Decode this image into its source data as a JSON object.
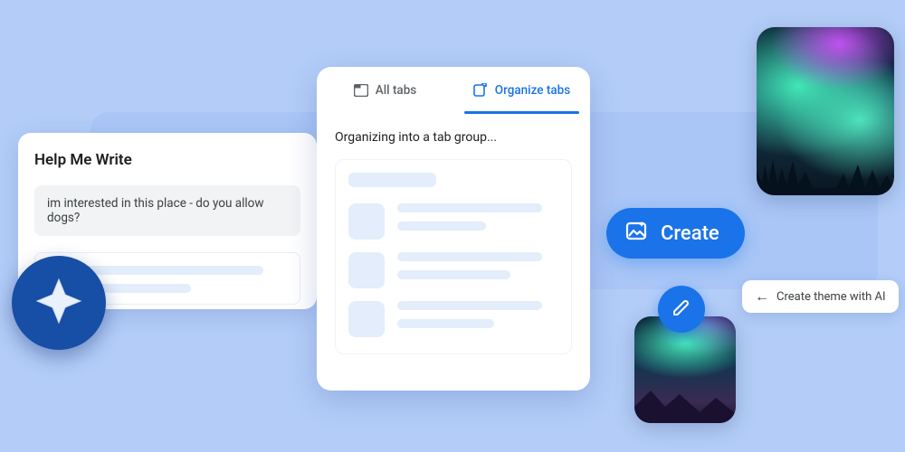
{
  "help_me_write": {
    "title": "Help Me Write",
    "input_text": "im interested in this place - do you allow dogs?"
  },
  "organize_tabs": {
    "tabs": [
      {
        "label": "All tabs",
        "icon": "tab-icon",
        "active": false
      },
      {
        "label": "Organize tabs",
        "icon": "organize-icon",
        "active": true
      }
    ],
    "status": "Organizing into a tab group..."
  },
  "create_button": {
    "label": "Create"
  },
  "theme_chip": {
    "label": "Create theme with AI",
    "arrow": "←"
  },
  "images": {
    "big": "aurora-large",
    "small": "aurora-small"
  },
  "icons": {
    "spark": "sparkle-icon",
    "edit": "pencil-icon",
    "create": "image-sparkle-icon"
  }
}
